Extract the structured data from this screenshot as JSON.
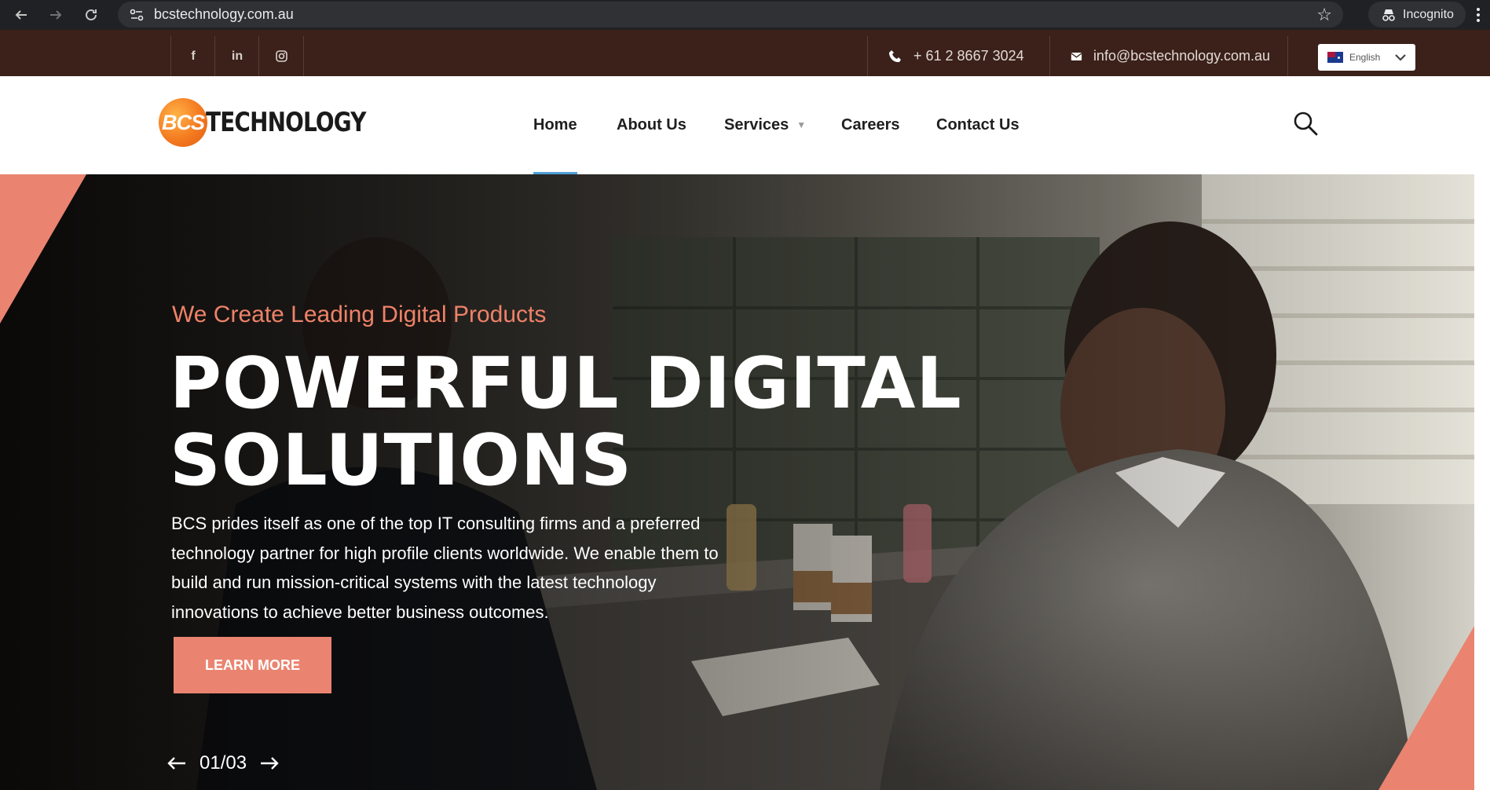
{
  "browser": {
    "url": "bcstechnology.com.au",
    "incognito_label": "Incognito"
  },
  "topbar": {
    "socials": [
      {
        "icon": "facebook-icon",
        "glyph": "f"
      },
      {
        "icon": "linkedin-icon",
        "glyph": "in"
      },
      {
        "icon": "instagram-icon",
        "glyph": "◎"
      }
    ],
    "phone": "+ 61 2 8667 3024",
    "email": "info@bcstechnology.com.au",
    "language": "English"
  },
  "header": {
    "logo_mark": "BCS",
    "logo_text": "TECHNOLOGY",
    "nav": [
      {
        "label": "Home",
        "active": true
      },
      {
        "label": "About Us",
        "active": false
      },
      {
        "label": "Services",
        "active": false,
        "has_dropdown": true
      },
      {
        "label": "Careers",
        "active": false
      },
      {
        "label": "Contact Us",
        "active": false
      }
    ]
  },
  "hero": {
    "subtitle": "We Create Leading Digital Products",
    "title_line1": "POWERFUL DIGITAL",
    "title_line2": "SOLUTIONS",
    "description": "BCS prides itself as one of the top IT consulting firms and a preferred technology partner for high profile clients worldwide. We enable them to build and run mission-critical systems with the latest technology innovations to achieve better business outcomes.",
    "cta_label": "LEARN MORE",
    "slide_counter": "01/03"
  },
  "colors": {
    "topbar_bg": "#3b211a",
    "accent": "#ea8470",
    "subtitle": "#ee8268",
    "active_underline": "#4f9fd6"
  }
}
